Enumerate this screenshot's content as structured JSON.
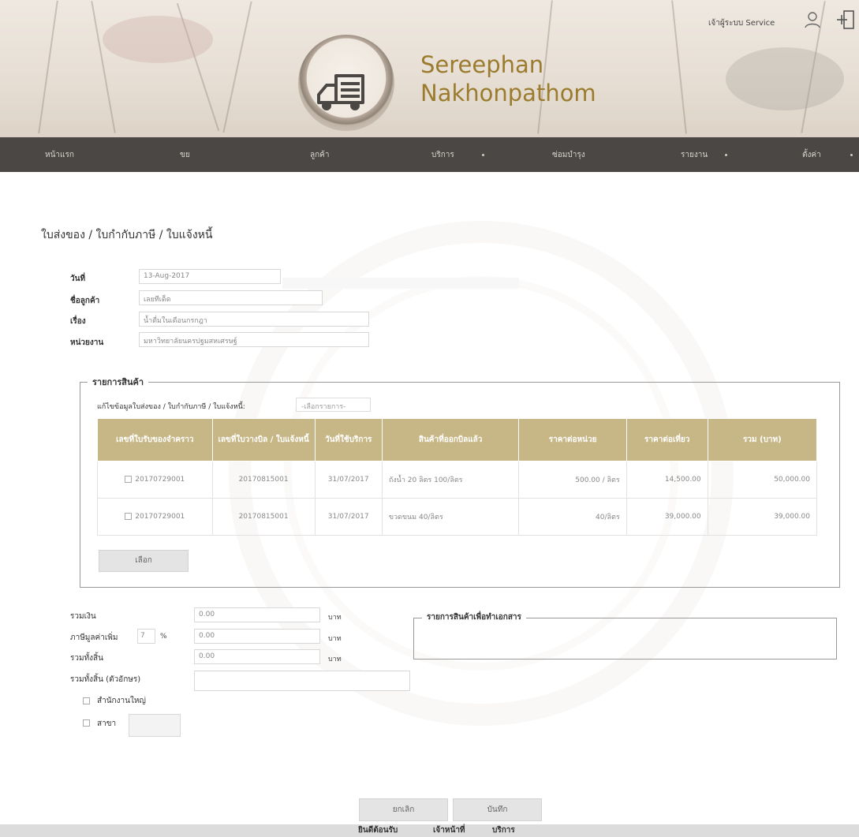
{
  "header": {
    "brand_line1": "Sereephan",
    "brand_line2": "Nakhonpathom",
    "user_label": "เจ้าผู้ระบบ Service"
  },
  "nav": {
    "items": [
      "หน้าแรก",
      "ขย",
      "ลูกค้า",
      "บริการ",
      "ซ่อมบำรุง",
      "รายงาน",
      "ตั้งค่า"
    ]
  },
  "page": {
    "title": "ใบส่งของ / ใบกำกับภาษี / ใบแจ้งหนี้"
  },
  "info": {
    "date_label": "วันที่",
    "date_value": "13-Aug-2017",
    "customer_label": "ชื่อลูกค้า",
    "customer_value": "เลยทีเด็ด",
    "subject_label": "เรื่อง",
    "subject_value": "น้ำดื่มในเดือนกรกฎา",
    "agency_label": "หน่วยงาน",
    "agency_value": "มหาวิทยาลัยนครปฐมสหเศรษฐ์"
  },
  "products": {
    "legend": "รายการสินค้า",
    "edit_label": "แก้ไขข้อมูลใบส่งของ / ใบกำกับภาษี / ใบแจ้งหนี้:",
    "select_placeholder": "-เลือกรายการ-",
    "columns": [
      "เลขที่ใบรับของจำคราว",
      "เลขที่ใบวางบิล / ใบแจ้งหนี้",
      "วันที่ใช้บริการ",
      "สินค้าที่ออกบิลแล้ว",
      "ราคาต่อหน่วย",
      "ราคาต่อเที่ยว",
      "รวม (บาท)"
    ],
    "rows": [
      [
        "20170729001",
        "20170815001",
        "31/07/2017",
        "ถังน้ำ 20 ลิตร 100/ลิตร",
        "500.00 / ลิตร",
        "14,500.00",
        "50,000.00"
      ],
      [
        "20170729001",
        "20170815001",
        "31/07/2017",
        "ขวดขนม 40/ลิตร",
        "40/ลิตร",
        "39,000.00",
        "39,000.00"
      ]
    ],
    "select_button": "เลือก"
  },
  "totals": {
    "subtotal_label": "รวมเงิน",
    "subtotal_value": "0.00",
    "vat_label": "ภาษีมูลค่าเพิ่ม",
    "vat_rate": "7",
    "percent_sign": "%",
    "vat_value": "0.00",
    "grand_label": "รวมทั้งสิ้น",
    "grand_value": "0.00",
    "grand_text_label": "รวมทั้งสิ้น (ตัวอักษร)",
    "unit": "บาท",
    "head_office_label": "สำนักงานใหญ่",
    "branch_label": "สาขา",
    "doc_items_legend": "รายการสินค้าเพื่อทำเอกสาร"
  },
  "actions": {
    "cancel_label": "ยกเลิก",
    "save_label": "บันทึก"
  },
  "footer": {
    "items": [
      "ยินดีต้อนรับ",
      "เจ้าหน้าที่",
      "บริการ"
    ]
  }
}
